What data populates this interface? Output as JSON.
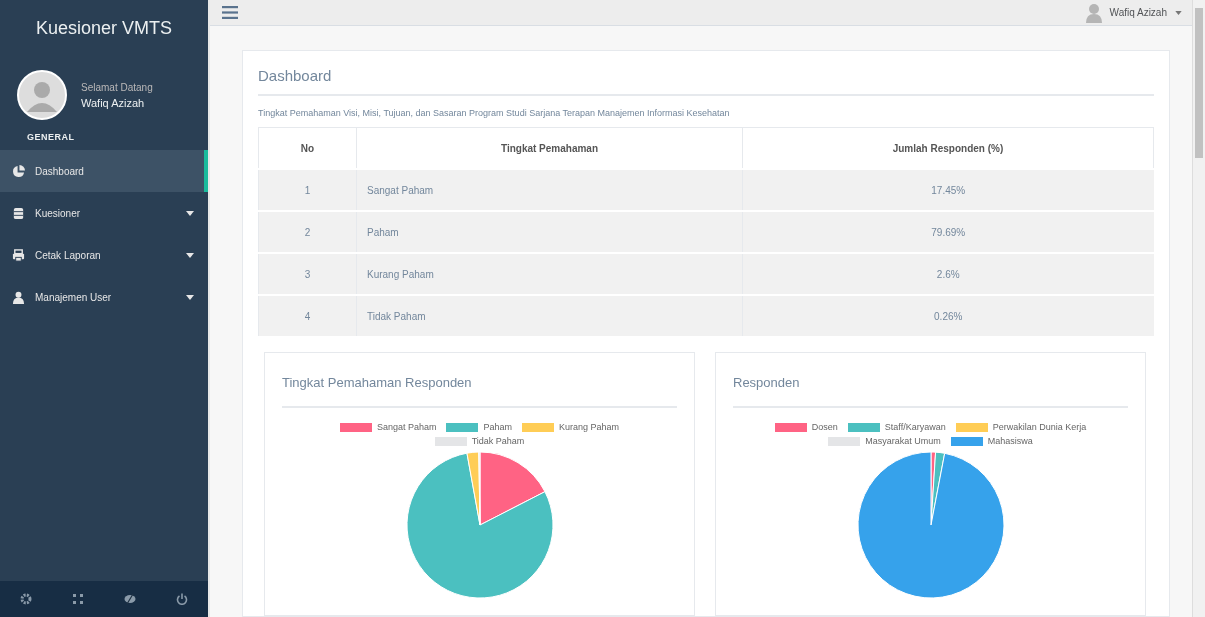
{
  "sidebar": {
    "brand": "Kuesioner VMTS",
    "greeting": "Selamat Datang",
    "user_name": "Wafiq Azizah",
    "section": "GENERAL",
    "items": [
      {
        "label": "Dashboard",
        "selected": true,
        "expandable": false
      },
      {
        "label": "Kuesioner",
        "selected": false,
        "expandable": true
      },
      {
        "label": "Cetak Laporan",
        "selected": false,
        "expandable": true
      },
      {
        "label": "Manajemen User",
        "selected": false,
        "expandable": true
      }
    ]
  },
  "topbar": {
    "user_name": "Wafiq Azizah"
  },
  "panel": {
    "title": "Dashboard",
    "subtitle": "Tingkat Pemahaman Visi, Misi, Tujuan, dan Sasaran Program Studi Sarjana Terapan Manajemen Informasi Kesehatan",
    "table": {
      "columns": [
        "No",
        "Tingkat Pemahaman",
        "Jumlah Responden (%)"
      ],
      "rows": [
        [
          "1",
          "Sangat Paham",
          "17.45%"
        ],
        [
          "2",
          "Paham",
          "79.69%"
        ],
        [
          "3",
          "Kurang Paham",
          "2.6%"
        ],
        [
          "4",
          "Tidak Paham",
          "0.26%"
        ]
      ]
    }
  },
  "charts": [
    {
      "title": "Tingkat Pemahaman Responden",
      "legend": [
        {
          "label": "Sangat Paham",
          "color": "#ff6384"
        },
        {
          "label": "Paham",
          "color": "#4bc0c0"
        },
        {
          "label": "Kurang Paham",
          "color": "#ffcd56"
        },
        {
          "label": "Tidak Paham",
          "color": "#e4e5e7"
        }
      ]
    },
    {
      "title": "Responden",
      "legend": [
        {
          "label": "Dosen",
          "color": "#ff6384"
        },
        {
          "label": "Staff/Karyawan",
          "color": "#4bc0c0"
        },
        {
          "label": "Perwakilan Dunia Kerja",
          "color": "#ffcd56"
        },
        {
          "label": "Masyarakat Umum",
          "color": "#e4e5e7"
        },
        {
          "label": "Mahasiswa",
          "color": "#36a2eb"
        }
      ]
    }
  ]
}
